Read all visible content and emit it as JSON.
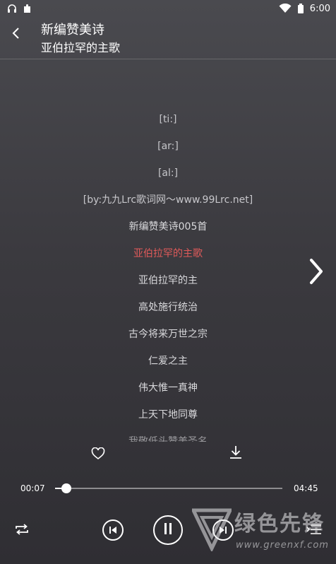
{
  "status_bar": {
    "time": "6:00"
  },
  "header": {
    "title": "新编赞美诗",
    "subtitle": "亚伯拉罕的主歌"
  },
  "lyrics": [
    {
      "text": "[ti:]",
      "kind": "meta"
    },
    {
      "text": "[ar:]",
      "kind": "meta"
    },
    {
      "text": "[al:]",
      "kind": "meta"
    },
    {
      "text": "[by:九九Lrc歌词网～www.99Lrc.net]",
      "kind": "meta"
    },
    {
      "text": "新编赞美诗005首",
      "kind": "normal"
    },
    {
      "text": "亚伯拉罕的主歌",
      "kind": "active"
    },
    {
      "text": "亚伯拉罕的主",
      "kind": "normal"
    },
    {
      "text": "高处施行统治",
      "kind": "normal"
    },
    {
      "text": "古今将来万世之宗",
      "kind": "normal"
    },
    {
      "text": "仁爱之主",
      "kind": "normal"
    },
    {
      "text": "伟大惟一真神",
      "kind": "normal"
    },
    {
      "text": "上天下地同尊",
      "kind": "normal"
    },
    {
      "text": "我敬低头赞美圣名",
      "kind": "fade"
    }
  ],
  "player": {
    "current_time": "00:07",
    "total_time": "04:45",
    "progress_fraction": 0.05
  },
  "colors": {
    "active_lyric": "#e05a5a",
    "accent": "#ffffff"
  },
  "icons": {
    "back": "chevron-left-icon",
    "next_page": "chevron-right-icon",
    "heart": "heart-icon",
    "download": "download-icon",
    "repeat": "repeat-icon",
    "previous": "skip-previous-icon",
    "pause": "pause-icon",
    "next": "skip-next-icon",
    "playlist": "playlist-icon"
  },
  "watermark": {
    "text": "绿色先锋",
    "url": "www.greenxf.com"
  }
}
